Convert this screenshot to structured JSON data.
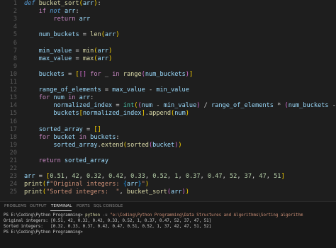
{
  "editor": {
    "lines": [
      {
        "num": "1",
        "tokens": [
          [
            "kw2",
            "def "
          ],
          [
            "fn",
            "bucket_sort"
          ],
          [
            "brk1",
            "("
          ],
          [
            "var",
            "arr"
          ],
          [
            "brk1",
            ")"
          ],
          [
            "op",
            ":"
          ]
        ]
      },
      {
        "num": "2",
        "tokens": [
          [
            "op",
            "    "
          ],
          [
            "kw",
            "if "
          ],
          [
            "kw2",
            "not "
          ],
          [
            "var",
            "arr"
          ],
          [
            "op",
            ":"
          ]
        ]
      },
      {
        "num": "3",
        "tokens": [
          [
            "op",
            "        "
          ],
          [
            "kw",
            "return "
          ],
          [
            "var",
            "arr"
          ]
        ]
      },
      {
        "num": "4",
        "tokens": []
      },
      {
        "num": "5",
        "tokens": [
          [
            "op",
            "    "
          ],
          [
            "var",
            "num_buckets"
          ],
          [
            "op",
            " = "
          ],
          [
            "fn",
            "len"
          ],
          [
            "brk1",
            "("
          ],
          [
            "var",
            "arr"
          ],
          [
            "brk1",
            ")"
          ]
        ]
      },
      {
        "num": "6",
        "tokens": []
      },
      {
        "num": "7",
        "tokens": [
          [
            "op",
            "    "
          ],
          [
            "var",
            "min_value"
          ],
          [
            "op",
            " = "
          ],
          [
            "fn",
            "min"
          ],
          [
            "brk1",
            "("
          ],
          [
            "var",
            "arr"
          ],
          [
            "brk1",
            ")"
          ]
        ]
      },
      {
        "num": "8",
        "tokens": [
          [
            "op",
            "    "
          ],
          [
            "var",
            "max_value"
          ],
          [
            "op",
            " = "
          ],
          [
            "fn",
            "max"
          ],
          [
            "brk1",
            "("
          ],
          [
            "var",
            "arr"
          ],
          [
            "brk1",
            ")"
          ]
        ]
      },
      {
        "num": "9",
        "tokens": []
      },
      {
        "num": "10",
        "tokens": [
          [
            "op",
            "    "
          ],
          [
            "var",
            "buckets"
          ],
          [
            "op",
            " = "
          ],
          [
            "brk1",
            "["
          ],
          [
            "brk2",
            "[]"
          ],
          [
            "op",
            " "
          ],
          [
            "kw",
            "for"
          ],
          [
            "op",
            " _ "
          ],
          [
            "kw",
            "in "
          ],
          [
            "fn",
            "range"
          ],
          [
            "brk2",
            "("
          ],
          [
            "var",
            "num_buckets"
          ],
          [
            "brk2",
            ")"
          ],
          [
            "brk1",
            "]"
          ]
        ]
      },
      {
        "num": "11",
        "tokens": []
      },
      {
        "num": "12",
        "tokens": [
          [
            "op",
            "    "
          ],
          [
            "var",
            "range_of_elements"
          ],
          [
            "op",
            " = "
          ],
          [
            "var",
            "max_value"
          ],
          [
            "op",
            " - "
          ],
          [
            "var",
            "min_value"
          ]
        ]
      },
      {
        "num": "13",
        "tokens": [
          [
            "op",
            "    "
          ],
          [
            "kw",
            "for "
          ],
          [
            "var",
            "num"
          ],
          [
            "kw",
            " in "
          ],
          [
            "var",
            "arr"
          ],
          [
            "op",
            ":"
          ]
        ]
      },
      {
        "num": "14",
        "tokens": [
          [
            "op",
            "        "
          ],
          [
            "var",
            "normalized_index"
          ],
          [
            "op",
            " = "
          ],
          [
            "cls",
            "int"
          ],
          [
            "brk1",
            "("
          ],
          [
            "brk2",
            "("
          ],
          [
            "var",
            "num"
          ],
          [
            "op",
            " - "
          ],
          [
            "var",
            "min_value"
          ],
          [
            "brk2",
            ")"
          ],
          [
            "op",
            " / "
          ],
          [
            "var",
            "range_of_elements"
          ],
          [
            "op",
            " * "
          ],
          [
            "brk2",
            "("
          ],
          [
            "var",
            "num_buckets"
          ],
          [
            "op",
            " - "
          ],
          [
            "num",
            "1"
          ],
          [
            "brk2",
            ")"
          ],
          [
            "brk1",
            ")"
          ]
        ]
      },
      {
        "num": "15",
        "tokens": [
          [
            "op",
            "        "
          ],
          [
            "var",
            "buckets"
          ],
          [
            "brk1",
            "["
          ],
          [
            "var",
            "normalized_index"
          ],
          [
            "brk1",
            "]"
          ],
          [
            "op",
            "."
          ],
          [
            "fn",
            "append"
          ],
          [
            "brk1",
            "("
          ],
          [
            "var",
            "num"
          ],
          [
            "brk1",
            ")"
          ]
        ]
      },
      {
        "num": "16",
        "tokens": []
      },
      {
        "num": "17",
        "tokens": [
          [
            "op",
            "    "
          ],
          [
            "var",
            "sorted_array"
          ],
          [
            "op",
            " = "
          ],
          [
            "brk1",
            "[]"
          ]
        ]
      },
      {
        "num": "18",
        "tokens": [
          [
            "op",
            "    "
          ],
          [
            "kw",
            "for "
          ],
          [
            "var",
            "bucket"
          ],
          [
            "kw",
            " in "
          ],
          [
            "var",
            "buckets"
          ],
          [
            "op",
            ":"
          ]
        ]
      },
      {
        "num": "19",
        "tokens": [
          [
            "op",
            "        "
          ],
          [
            "var",
            "sorted_array"
          ],
          [
            "op",
            "."
          ],
          [
            "fn",
            "extend"
          ],
          [
            "brk1",
            "("
          ],
          [
            "fn",
            "sorted"
          ],
          [
            "brk2",
            "("
          ],
          [
            "var",
            "bucket"
          ],
          [
            "brk2",
            ")"
          ],
          [
            "brk1",
            ")"
          ]
        ]
      },
      {
        "num": "20",
        "tokens": []
      },
      {
        "num": "21",
        "tokens": [
          [
            "op",
            "    "
          ],
          [
            "kw",
            "return "
          ],
          [
            "var",
            "sorted_array"
          ]
        ]
      },
      {
        "num": "22",
        "tokens": []
      },
      {
        "num": "23",
        "tokens": [
          [
            "var",
            "arr"
          ],
          [
            "op",
            " = "
          ],
          [
            "brk1",
            "["
          ],
          [
            "num",
            "0.51"
          ],
          [
            "op",
            ", "
          ],
          [
            "num",
            "42"
          ],
          [
            "op",
            ", "
          ],
          [
            "num",
            "0.32"
          ],
          [
            "op",
            ", "
          ],
          [
            "num",
            "0.42"
          ],
          [
            "op",
            ", "
          ],
          [
            "num",
            "0.33"
          ],
          [
            "op",
            ", "
          ],
          [
            "num",
            "0.52"
          ],
          [
            "op",
            ", "
          ],
          [
            "num",
            "1"
          ],
          [
            "op",
            ", "
          ],
          [
            "num",
            "0.37"
          ],
          [
            "op",
            ", "
          ],
          [
            "num",
            "0.47"
          ],
          [
            "op",
            ", "
          ],
          [
            "num",
            "52"
          ],
          [
            "op",
            ", "
          ],
          [
            "num",
            "37"
          ],
          [
            "op",
            ", "
          ],
          [
            "num",
            "47"
          ],
          [
            "op",
            ", "
          ],
          [
            "num",
            "51"
          ],
          [
            "brk1",
            "]"
          ]
        ]
      },
      {
        "num": "24",
        "tokens": [
          [
            "fn",
            "print"
          ],
          [
            "brk1",
            "("
          ],
          [
            "var",
            "f"
          ],
          [
            "str",
            "\"Original integers: "
          ],
          [
            "brk3",
            "{"
          ],
          [
            "var",
            "arr"
          ],
          [
            "brk3",
            "}"
          ],
          [
            "str",
            "\""
          ],
          [
            "brk1",
            ")"
          ]
        ]
      },
      {
        "num": "25",
        "tokens": [
          [
            "fn",
            "print"
          ],
          [
            "brk1",
            "("
          ],
          [
            "str",
            "\"Sorted integers:  \""
          ],
          [
            "op",
            ", "
          ],
          [
            "fn",
            "bucket_sort"
          ],
          [
            "brk2",
            "("
          ],
          [
            "var",
            "arr"
          ],
          [
            "brk2",
            ")"
          ],
          [
            "brk1",
            ")"
          ]
        ]
      }
    ]
  },
  "panel": {
    "tabs": [
      "PROBLEMS",
      "OUTPUT",
      "TERMINAL",
      "PORTS",
      "SQL CONSOLE"
    ],
    "active_tab": "TERMINAL",
    "terminal": {
      "prompt": "PS E:\\Coding\\Python Programming> ",
      "command": "python",
      "option": " -u ",
      "path": "\"e:\\Coding\\Python Programming\\Data Structures and Algorithms\\Sorting algorithm",
      "output_1": "Original integers: [0.51, 42, 0.32, 0.42, 0.33, 0.52, 1, 0.37, 0.47, 52, 37, 47, 51]",
      "output_2": "Sorted integers:   [0.32, 0.33, 0.37, 0.42, 0.47, 0.51, 0.52, 1, 37, 42, 47, 51, 52]",
      "prompt_2": "PS E:\\Coding\\Python Programming> "
    }
  }
}
